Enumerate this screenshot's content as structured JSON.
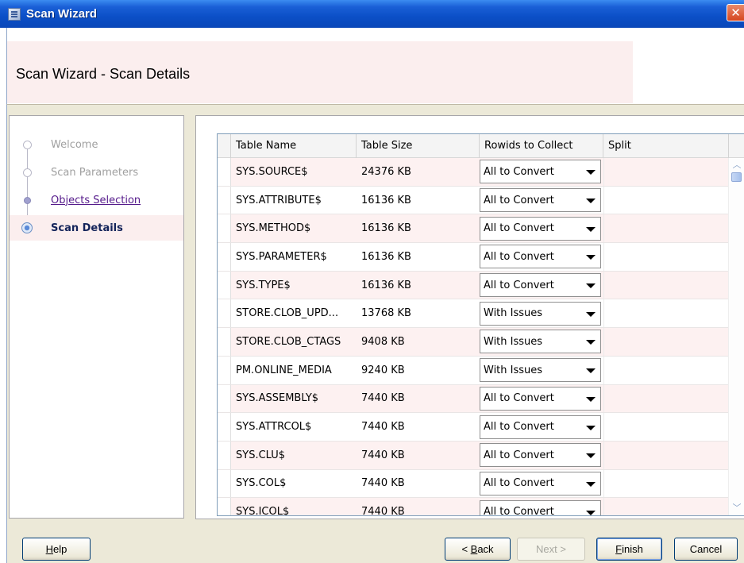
{
  "window": {
    "title": "Scan Wizard"
  },
  "header": {
    "title": "Scan Wizard - Scan Details"
  },
  "steps": [
    {
      "label": "Welcome",
      "state": "disabled"
    },
    {
      "label": "Scan Parameters",
      "state": "disabled"
    },
    {
      "label": "Objects Selection",
      "state": "link"
    },
    {
      "label": "Scan Details",
      "state": "current"
    }
  ],
  "table": {
    "columns": [
      "Table Name",
      "Table Size",
      "Rowids to Collect",
      "Split"
    ],
    "rows": [
      {
        "name": "SYS.SOURCE$",
        "size": "24376 KB",
        "rowids": "All to Convert",
        "split": ""
      },
      {
        "name": "SYS.ATTRIBUTE$",
        "size": "16136 KB",
        "rowids": "All to Convert",
        "split": ""
      },
      {
        "name": "SYS.METHOD$",
        "size": "16136 KB",
        "rowids": "All to Convert",
        "split": ""
      },
      {
        "name": "SYS.PARAMETER$",
        "size": "16136 KB",
        "rowids": "All to Convert",
        "split": ""
      },
      {
        "name": "SYS.TYPE$",
        "size": "16136 KB",
        "rowids": "All to Convert",
        "split": ""
      },
      {
        "name": "STORE.CLOB_UPD...",
        "size": "13768 KB",
        "rowids": "With Issues",
        "split": ""
      },
      {
        "name": "STORE.CLOB_CTAGS",
        "size": "9408 KB",
        "rowids": "With Issues",
        "split": ""
      },
      {
        "name": "PM.ONLINE_MEDIA",
        "size": "9240 KB",
        "rowids": "With Issues",
        "split": ""
      },
      {
        "name": "SYS.ASSEMBLY$",
        "size": "7440 KB",
        "rowids": "All to Convert",
        "split": ""
      },
      {
        "name": "SYS.ATTRCOL$",
        "size": "7440 KB",
        "rowids": "All to Convert",
        "split": ""
      },
      {
        "name": "SYS.CLU$",
        "size": "7440 KB",
        "rowids": "All to Convert",
        "split": ""
      },
      {
        "name": "SYS.COL$",
        "size": "7440 KB",
        "rowids": "All to Convert",
        "split": ""
      },
      {
        "name": "SYS.ICOL$",
        "size": "7440 KB",
        "rowids": "All to Convert",
        "split": ""
      }
    ]
  },
  "buttons": {
    "help": {
      "pre": "",
      "mnemonic": "H",
      "post": "elp"
    },
    "back": {
      "pre": "< ",
      "mnemonic": "B",
      "post": "ack"
    },
    "next": "Next >",
    "finish": {
      "pre": "",
      "mnemonic": "F",
      "post": "inish"
    },
    "cancel": "Cancel"
  },
  "colors": {
    "titlebar": "#0b4fc7",
    "stripe": "#fdf1f1",
    "current_step_bg": "#fbeeee"
  },
  "icons": {
    "window": "wizard-app-icon",
    "close": "close-icon",
    "dropdown": "chevron-down-icon"
  }
}
